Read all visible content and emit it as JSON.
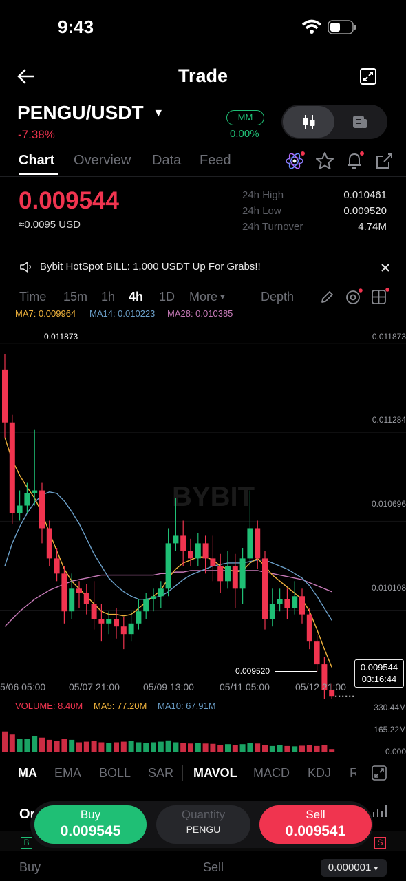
{
  "status_bar": {
    "time": "9:43"
  },
  "header": {
    "title": "Trade"
  },
  "pair": {
    "symbol": "PENGU/USDT",
    "change": "-7.38%",
    "mm_label": "MM",
    "mm_value": "0.00%"
  },
  "tabs": [
    {
      "label": "Chart",
      "active": true
    },
    {
      "label": "Overview",
      "active": false
    },
    {
      "label": "Data",
      "active": false
    },
    {
      "label": "Feed",
      "active": false
    }
  ],
  "ticker": {
    "last_price": "0.009544",
    "usd_value": "≈0.0095 USD",
    "stats": [
      {
        "label": "24h High",
        "value": "0.010461"
      },
      {
        "label": "24h Low",
        "value": "0.009520"
      },
      {
        "label": "24h Turnover",
        "value": "4.74M"
      }
    ]
  },
  "banner": {
    "text": "Bybit HotSpot BILL: 1,000 USDT Up For Grabs!!"
  },
  "timeframes": [
    {
      "label": "Time",
      "active": false
    },
    {
      "label": "15m",
      "active": false
    },
    {
      "label": "1h",
      "active": false
    },
    {
      "label": "4h",
      "active": true
    },
    {
      "label": "1D",
      "active": false
    },
    {
      "label": "More",
      "active": false
    }
  ],
  "depth_label": "Depth",
  "ma_legend": {
    "ma7": "MA7: 0.009964",
    "ma14": "MA14: 0.010223",
    "ma28": "MA28: 0.010385"
  },
  "chart_data": {
    "type": "candlestick",
    "y_ticks": [
      "0.011873",
      "0.011284",
      "0.010696",
      "0.010108"
    ],
    "x_labels": [
      "5/06 05:00",
      "05/07 21:00",
      "05/09 13:00",
      "05/11 05:00",
      "05/12 21:00"
    ],
    "high_marker": "0.011873",
    "low_marker": "0.009520",
    "current_price": "0.009544",
    "countdown": "03:16:44",
    "ylim": [
      0.0095,
      0.01205
    ],
    "candles": [
      [
        0.0117,
        0.01135,
        0.0118,
        0.01125
      ],
      [
        0.01135,
        0.01075,
        0.0114,
        0.01068
      ],
      [
        0.01075,
        0.0108,
        0.0109,
        0.0107
      ],
      [
        0.0108,
        0.01088,
        0.01095,
        0.01075
      ],
      [
        0.01088,
        0.0109,
        0.0113,
        0.0108
      ],
      [
        0.0109,
        0.01065,
        0.01095,
        0.01055
      ],
      [
        0.01065,
        0.01045,
        0.0107,
        0.0104
      ],
      [
        0.01045,
        0.01035,
        0.01052,
        0.0103
      ],
      [
        0.01035,
        0.0101,
        0.0104,
        0.01002
      ],
      [
        0.0101,
        0.01025,
        0.01035,
        0.01005
      ],
      [
        0.01025,
        0.01022,
        0.0103,
        0.01012
      ],
      [
        0.01022,
        0.01015,
        0.01028,
        0.01008
      ],
      [
        0.01015,
        0.01005,
        0.0103,
        0.00998
      ],
      [
        0.01005,
        0.01002,
        0.01015,
        0.0099
      ],
      [
        0.01002,
        0.01005,
        0.0101,
        0.00995
      ],
      [
        0.01005,
        0.01,
        0.01012,
        0.00992
      ],
      [
        0.01,
        0.00995,
        0.01006,
        0.00985
      ],
      [
        0.00995,
        0.01002,
        0.0101,
        0.0099
      ],
      [
        0.01002,
        0.0101,
        0.01018,
        0.00998
      ],
      [
        0.0101,
        0.01018,
        0.01022,
        0.01005
      ],
      [
        0.01018,
        0.0102,
        0.01025,
        0.0101
      ],
      [
        0.0102,
        0.01025,
        0.0103,
        0.01012
      ],
      [
        0.01025,
        0.01055,
        0.01065,
        0.0102
      ],
      [
        0.01055,
        0.0106,
        0.01085,
        0.0105
      ],
      [
        0.0106,
        0.0105,
        0.0107,
        0.0104
      ],
      [
        0.0105,
        0.01045,
        0.01058,
        0.0104
      ],
      [
        0.01045,
        0.01055,
        0.01062,
        0.0104
      ],
      [
        0.01055,
        0.01045,
        0.0106,
        0.01035
      ],
      [
        0.01045,
        0.0104,
        0.0106,
        0.0103
      ],
      [
        0.0104,
        0.0103,
        0.01048,
        0.01022
      ],
      [
        0.0103,
        0.0104,
        0.0105,
        0.01025
      ],
      [
        0.0104,
        0.01025,
        0.01048,
        0.01012
      ],
      [
        0.01025,
        0.01045,
        0.01052,
        0.01015
      ],
      [
        0.01045,
        0.01065,
        0.0109,
        0.0104
      ],
      [
        0.01065,
        0.01045,
        0.0107,
        0.01038
      ],
      [
        0.01045,
        0.01005,
        0.0105,
        0.00998
      ],
      [
        0.01005,
        0.01015,
        0.01025,
        0.01
      ],
      [
        0.01015,
        0.01018,
        0.01025,
        0.0101
      ],
      [
        0.01018,
        0.01012,
        0.01025,
        0.01005
      ],
      [
        0.01012,
        0.0102,
        0.0103,
        0.01008
      ],
      [
        0.0102,
        0.01008,
        0.01025,
        0.01002
      ],
      [
        0.01008,
        0.0099,
        0.01012,
        0.00985
      ],
      [
        0.0099,
        0.00975,
        0.00995,
        0.0097
      ],
      [
        0.00975,
        0.00958,
        0.0098,
        0.00952
      ],
      [
        0.00958,
        0.00954,
        0.00962,
        0.00952
      ]
    ],
    "ma7": [
      0.01125,
      0.0111,
      0.011,
      0.01092,
      0.01085,
      0.01075,
      0.01062,
      0.0105,
      0.01038,
      0.0103,
      0.01025,
      0.0102,
      0.01015,
      0.0101,
      0.01008,
      0.01008,
      0.01007,
      0.01008,
      0.01012,
      0.01016,
      0.0102,
      0.01024,
      0.01032,
      0.01038,
      0.01042,
      0.01044,
      0.01046,
      0.01046,
      0.01044,
      0.0104,
      0.01038,
      0.01036,
      0.01037,
      0.01042,
      0.01045,
      0.0104,
      0.01034,
      0.0103,
      0.01026,
      0.01022,
      0.01018,
      0.0101,
      0.00998,
      0.00985,
      0.00973
    ],
    "ma14": [
      0.0104,
      0.01055,
      0.01066,
      0.01075,
      0.01082,
      0.01087,
      0.01089,
      0.01088,
      0.01083,
      0.01076,
      0.01068,
      0.01058,
      0.01048,
      0.0104,
      0.01032,
      0.01027,
      0.01023,
      0.0102,
      0.01018,
      0.01018,
      0.01019,
      0.0102,
      0.01023,
      0.01027,
      0.01031,
      0.01034,
      0.01036,
      0.01038,
      0.0104,
      0.01041,
      0.01042,
      0.01042,
      0.01042,
      0.01043,
      0.01044,
      0.01044,
      0.01042,
      0.0104,
      0.01038,
      0.01035,
      0.01032,
      0.01027,
      0.0102,
      0.01012,
      0.01004
    ],
    "ma28": [
      0.01,
      0.01005,
      0.0101,
      0.01014,
      0.01018,
      0.01021,
      0.01024,
      0.01026,
      0.01028,
      0.0103,
      0.01031,
      0.01032,
      0.01033,
      0.01034,
      0.01034,
      0.01034,
      0.01034,
      0.01034,
      0.01034,
      0.01034,
      0.01034,
      0.01035,
      0.01035,
      0.01036,
      0.01036,
      0.01037,
      0.01037,
      0.01037,
      0.01037,
      0.01037,
      0.01037,
      0.01037,
      0.01037,
      0.01037,
      0.01037,
      0.01036,
      0.01035,
      0.01034,
      0.01033,
      0.01032,
      0.01031,
      0.01029,
      0.01027,
      0.01025,
      0.01023
    ],
    "volume_ticks": [
      "330.44M",
      "165.22M",
      "0.000"
    ],
    "volume_ylim": [
      0,
      330.44
    ],
    "volumes": [
      65,
      55,
      40,
      42,
      50,
      45,
      38,
      35,
      40,
      38,
      30,
      32,
      35,
      30,
      28,
      30,
      32,
      34,
      30,
      28,
      30,
      32,
      36,
      30,
      28,
      26,
      28,
      26,
      25,
      22,
      24,
      22,
      24,
      28,
      26,
      22,
      18,
      20,
      18,
      17,
      19,
      22,
      18,
      20,
      8.4
    ]
  },
  "volume_legend": {
    "volume": "VOLUME: 8.40M",
    "ma5": "MA5: 77.20M",
    "ma10": "MA10: 67.91M"
  },
  "indicators": [
    {
      "label": "MA",
      "active": true
    },
    {
      "label": "EMA",
      "active": false
    },
    {
      "label": "BOLL",
      "active": false
    },
    {
      "label": "SAR",
      "active": false
    },
    {
      "label": "MAVOL",
      "active": true
    },
    {
      "label": "MACD",
      "active": false
    },
    {
      "label": "KDJ",
      "active": false
    },
    {
      "label": "R",
      "active": false
    }
  ],
  "order_bar": {
    "buy_label": "Buy",
    "buy_price": "0.009545",
    "qty_label": "Quantity",
    "qty_unit": "PENGU",
    "sell_label": "Sell",
    "sell_price": "0.009541"
  },
  "bottom": {
    "tab_partial": "Or",
    "buy": "Buy",
    "sell": "Sell",
    "step": "0.000001",
    "b_badge": "B",
    "s_badge": "S"
  },
  "colors": {
    "up": "#1fbf75",
    "down": "#f0344f",
    "ma7": "#f0b33c",
    "ma14": "#6a9ec7",
    "ma28": "#c77ab8"
  }
}
